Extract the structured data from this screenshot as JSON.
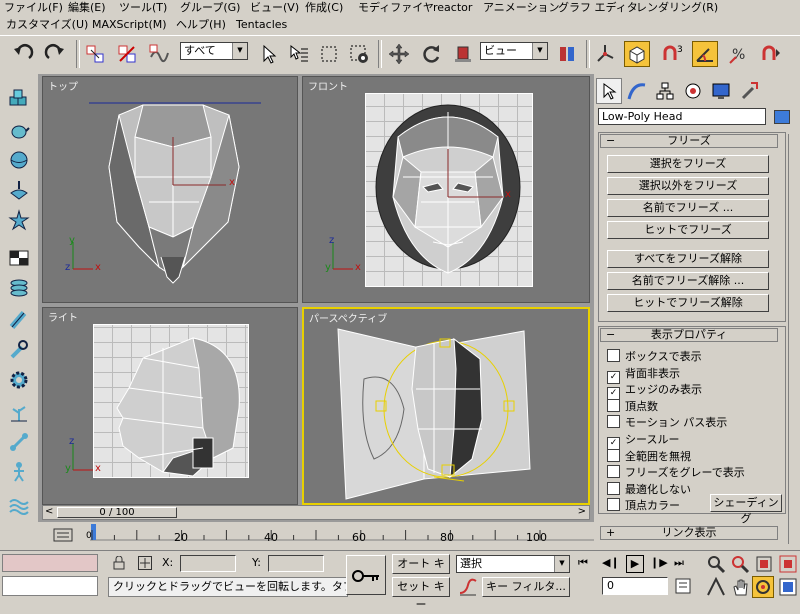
{
  "menu": {
    "row1": [
      "ファイル(F)",
      "編集(E)",
      "ツール(T)",
      "グループ(G)",
      "ビュー(V)",
      "作成(C)",
      "モディファイヤ",
      "reactor",
      "アニメーション",
      "グラフ エディタ",
      "レンダリング(R)"
    ],
    "row2": [
      "カスタマイズ(U)",
      "MAXScript(M)",
      "ヘルプ(H)",
      "Tentacles"
    ]
  },
  "toolbar": {
    "selection_filter": "すべて",
    "reference_coord": "ビュー",
    "icons": [
      "undo-icon",
      "redo-icon",
      "select-link-icon",
      "unlink-icon",
      "bind-spacewarp-icon",
      "select-object-icon",
      "select-by-name-icon",
      "rectangle-region-icon",
      "window-crossing-icon",
      "move-icon",
      "rotate-icon",
      "scale-icon",
      "pivot-icon",
      "manipulate-icon",
      "keyboard-override-icon",
      "snap-3d-icon",
      "angle-snap-icon",
      "percent-snap-icon",
      "spinner-snap-icon"
    ]
  },
  "viewports": {
    "top": "トップ",
    "front": "フロント",
    "left": "ライト",
    "perspective": "パースペクティブ"
  },
  "axes": {
    "x": "x",
    "y": "y",
    "z": "z"
  },
  "command_panel": {
    "object_name": "Low-Poly Head",
    "object_color": "#3d7bd9",
    "freeze_rollout": {
      "title": "フリーズ",
      "buttons": [
        "選択をフリーズ",
        "選択以外をフリーズ",
        "名前でフリーズ ...",
        "ヒットでフリーズ",
        "すべてをフリーズ解除",
        "名前でフリーズ解除 ...",
        "ヒットでフリーズ解除"
      ]
    },
    "display_props": {
      "title": "表示プロパティ",
      "options": [
        {
          "label": "ボックスで表示",
          "checked": false
        },
        {
          "label": "背面非表示",
          "checked": true
        },
        {
          "label": "エッジのみ表示",
          "checked": true
        },
        {
          "label": "頂点数",
          "checked": false
        },
        {
          "label": "モーション パス表示",
          "checked": false
        },
        {
          "label": "シースルー",
          "checked": true
        },
        {
          "label": "全範囲を無視",
          "checked": false
        },
        {
          "label": "フリーズをグレーで表示",
          "checked": false
        },
        {
          "label": "最適化しない",
          "checked": false
        },
        {
          "label": "頂点カラー",
          "checked": false
        }
      ],
      "shading_button": "シェーディング"
    },
    "link_rollout": {
      "title": "リンク表示"
    },
    "collapse_sign": "−",
    "expand_sign": "+"
  },
  "timeline": {
    "frame_counter": "0 / 100",
    "ticks": [
      "0",
      "20",
      "40",
      "60",
      "80",
      "100"
    ],
    "prev_arrow": "<",
    "next_arrow": ">"
  },
  "status": {
    "prompt": "クリックとドラッグでビューを回転します。タブ内でのク",
    "x_label": "X:",
    "y_label": "Y:",
    "auto_key": "オート キー",
    "set_key": "セット キー",
    "key_mode": "選択",
    "key_filter": "キー フィルタ...",
    "current_frame": "0"
  },
  "colors": {
    "accent_active": "#f5c33b",
    "active_viewport_border": "#e8d000",
    "prompt_field": "#e3c7c7"
  }
}
